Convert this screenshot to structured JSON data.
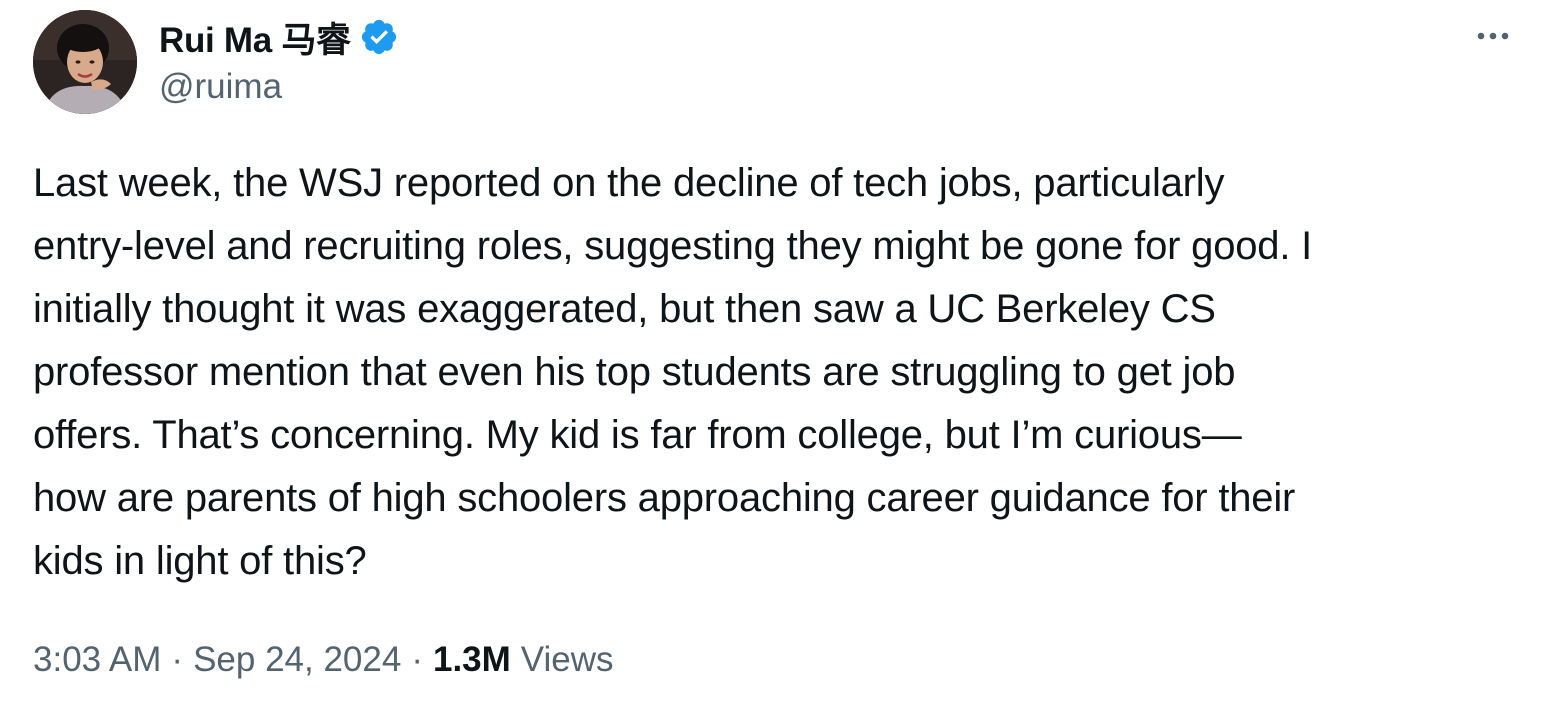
{
  "author": {
    "name": "Rui Ma 马睿",
    "handle": "@ruima",
    "verified_icon": "verified-badge-icon",
    "verified_color": "#1d9bf0"
  },
  "more_icon": "more-horizontal-icon",
  "tweet": {
    "text": "Last week, the WSJ reported on the decline of tech jobs, particularly\nentry-level and recruiting roles, suggesting they might be gone for good. I\ninitially thought it was exaggerated, but then saw a UC Berkeley CS\nprofessor mention that even his top students are struggling to get job\noffers. That’s concerning. My kid is far from college, but I’m curious—\nhow are parents of high schoolers approaching career guidance for their\nkids in light of this?"
  },
  "meta": {
    "time": "3:03 AM",
    "separator": "·",
    "date": "Sep 24, 2024",
    "views_count": "1.3M",
    "views_label": "Views"
  },
  "colors": {
    "text_primary": "#0f1419",
    "text_secondary": "#536471",
    "background": "#ffffff"
  }
}
